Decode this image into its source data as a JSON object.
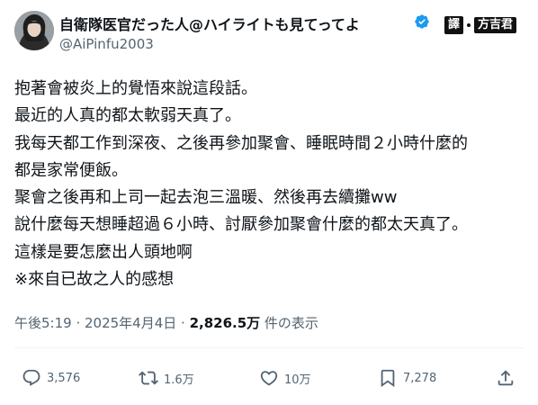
{
  "author": {
    "display_name": "自衛隊医官だった人@ハイライトも見てってよ",
    "handle": "@AiPinfu2003",
    "verified": true,
    "avatar": "avatar-photo"
  },
  "watermark": {
    "badge": "譯",
    "name": "方吉君"
  },
  "tweet": {
    "lines": [
      "抱著會被炎上的覺悟來說這段話。",
      "最近的人真的都太軟弱天真了。",
      "我每天都工作到深夜、之後再參加聚會、睡眠時間２小時什麼的",
      "都是家常便飯。",
      "聚會之後再和上司一起去泡三溫暖、然後再去續攤ww",
      "說什麼每天想睡超過６小時、討厭參加聚會什麼的都太天真了。",
      "這樣是要怎麼出人頭地啊",
      "※來自已故之人的感想"
    ]
  },
  "meta": {
    "timestamp": "午後5:19 · 2025年4月4日 · ",
    "views_count": "2,826.5万",
    "views_label": " 件の表示"
  },
  "actions": {
    "reply_count": "3,576",
    "retweet_count": "1.6万",
    "like_count": "10万",
    "bookmark_count": "7,278"
  },
  "colors": {
    "text": "#0f1419",
    "secondary": "#536471",
    "verified": "#1d9bf0",
    "divider": "#eff3f4"
  }
}
